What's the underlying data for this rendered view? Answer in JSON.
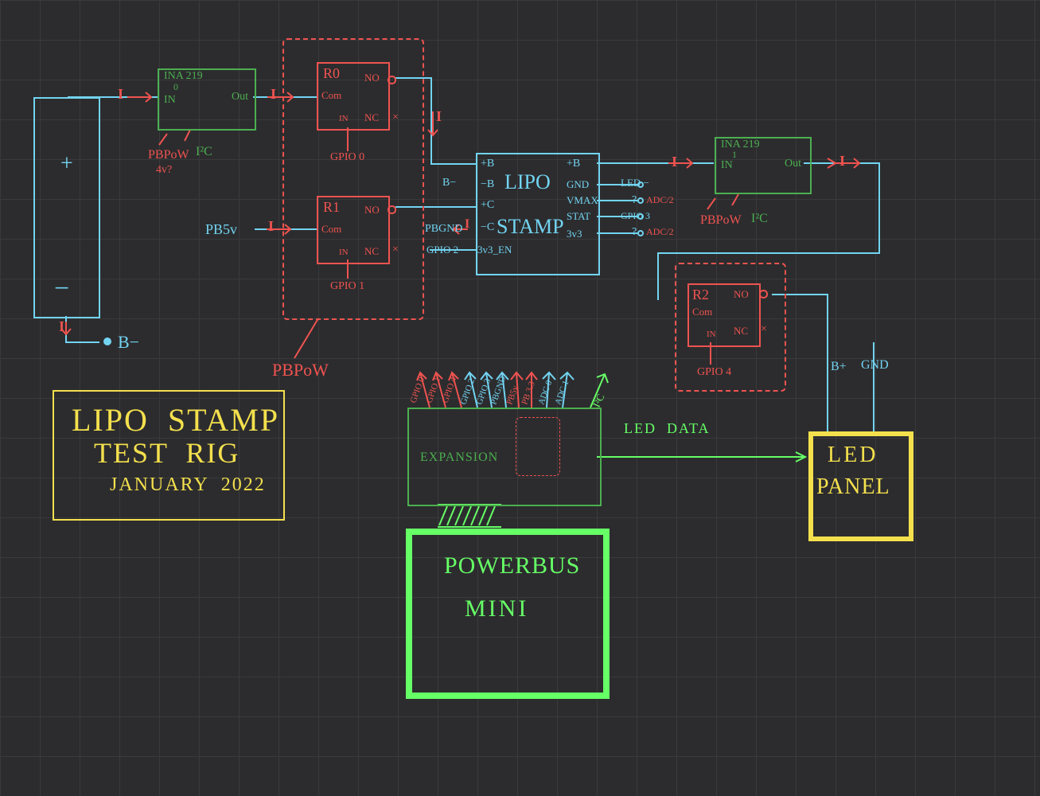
{
  "title": {
    "line1": "LIPO  STAMP",
    "line2": "TEST  RIG",
    "date": "JANUARY  2022"
  },
  "battery": {
    "plus": "+",
    "minus": "−",
    "b_minus": "B−"
  },
  "ina0": {
    "name": "INA 219",
    "addr": "0",
    "in": "IN",
    "out": "Out",
    "pbpow": "PBPoW",
    "v": "4v?",
    "i2c": "I²C"
  },
  "ina1": {
    "name": "INA 219",
    "addr": "1",
    "in": "IN",
    "out": "Out",
    "pbpow": "PBPoW",
    "i2c": "I²C"
  },
  "relay0": {
    "name": "R0",
    "com": "Com",
    "no": "NO",
    "nc": "NC",
    "in": "IN",
    "gpio": "GPIO 0"
  },
  "relay1": {
    "name": "R1",
    "com": "Com",
    "no": "NO",
    "nc": "NC",
    "in": "IN",
    "gpio": "GPIO 1"
  },
  "relay2": {
    "name": "R2",
    "com": "Com",
    "no": "NO",
    "nc": "NC",
    "in": "IN",
    "gpio": "GPIO 4"
  },
  "pb5v": "PB5v",
  "pbgnd": "PBGND",
  "pbpow": "PBPoW",
  "current": "I",
  "lipo": {
    "name1": "LIPO",
    "name2": "STAMP",
    "left": {
      "pB": "+B",
      "mB": "−B",
      "pC": "+C",
      "mC": "−C",
      "en": "3v3_EN",
      "gpio": "GPIO 2",
      "bm": "B−"
    },
    "right": {
      "pB": "+B",
      "gnd": "GND",
      "vmax": "VMAX",
      "stat": "STAT",
      "v3": "3v3",
      "led": "LED −",
      "q1": "?",
      "q2": "?",
      "adc1": "ADC/2",
      "adc2": "ADC/2",
      "gpio3": "GPIO 3"
    }
  },
  "led_panel": {
    "name1": "LED",
    "name2": "PANEL",
    "bplus": "B+",
    "gnd": "GND",
    "data": "LED  DATA"
  },
  "powerbus": {
    "name1": "POWERBUS",
    "name2": "MINI",
    "expansion": "EXPANSION"
  },
  "expansion_pins": {
    "gpio0": "GPIO 0",
    "gpio1": "GPIO 1",
    "gpio4": "GPIO 4",
    "gpio2": "GPIO 2",
    "gpio3": "GPIO 3",
    "pbgnd": "PBGND",
    "pb5v": "PB5v",
    "pb3v3": "PB 3.3",
    "adc0": "ADC 0",
    "adc1": "ADC 1",
    "i2c": "I²C"
  },
  "colors": {
    "cyan": "#72d4f2",
    "red": "#ef5350",
    "yellow": "#f4e04d",
    "grn_sensor": "#4caf50",
    "grn_bright": "#66ff66",
    "green_line": "#7fff7f"
  }
}
